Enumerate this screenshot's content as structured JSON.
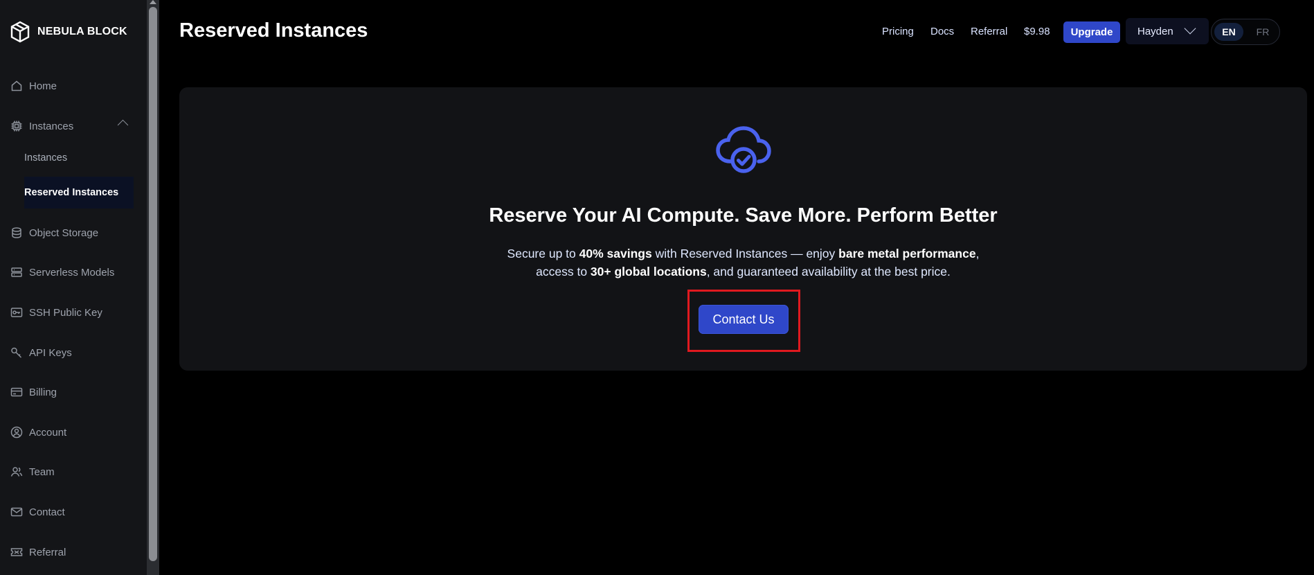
{
  "brand": {
    "name": "NEBULA BLOCK"
  },
  "sidebar": {
    "items": [
      {
        "label": "Home",
        "icon": "home-icon"
      },
      {
        "label": "Instances",
        "icon": "chip-icon",
        "expanded": true,
        "children": [
          {
            "label": "Instances",
            "active": false
          },
          {
            "label": "Reserved Instances",
            "active": true
          }
        ]
      },
      {
        "label": "Object Storage",
        "icon": "database-icon"
      },
      {
        "label": "Serverless Models",
        "icon": "server-icon"
      },
      {
        "label": "SSH Public Key",
        "icon": "key-card-icon"
      },
      {
        "label": "API Keys",
        "icon": "key-icon"
      },
      {
        "label": "Billing",
        "icon": "billing-icon"
      },
      {
        "label": "Account",
        "icon": "account-icon"
      },
      {
        "label": "Team",
        "icon": "team-icon"
      },
      {
        "label": "Contact",
        "icon": "mail-icon"
      },
      {
        "label": "Referral",
        "icon": "ticket-icon"
      }
    ]
  },
  "header": {
    "title": "Reserved Instances",
    "links": [
      "Pricing",
      "Docs",
      "Referral"
    ],
    "balance": "$9.98",
    "upgrade_label": "Upgrade",
    "user_name": "Hayden",
    "languages": {
      "active": "EN",
      "other": "FR"
    }
  },
  "hero": {
    "icon": "cloud-check-icon",
    "title": "Reserve Your AI Compute. Save More. Perform Better",
    "desc_1": "Secure up to ",
    "desc_bold_1": "40% savings",
    "desc_2": " with Reserved Instances — enjoy ",
    "desc_bold_2": "bare metal performance",
    "desc_3": ",",
    "desc_4": "access to ",
    "desc_bold_3": "30+ global locations",
    "desc_5": ", and guaranteed availability at the best price.",
    "cta_label": "Contact Us"
  },
  "colors": {
    "accent": "#2f47c9",
    "icon_accent": "#4a62ee",
    "highlight": "#e0191f",
    "card_bg": "#121316",
    "sidebar_bg": "#141518"
  }
}
